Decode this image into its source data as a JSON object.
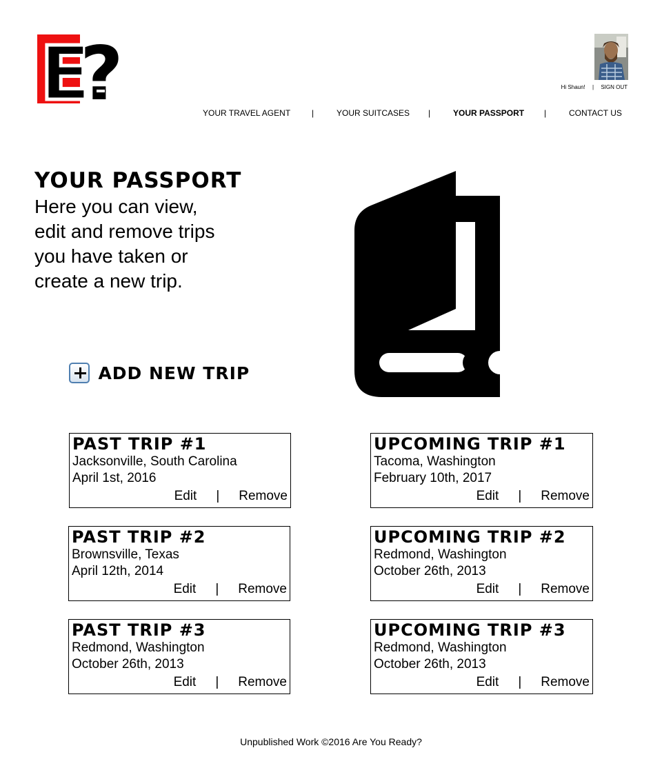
{
  "header": {
    "logo_letters": "E?",
    "greeting": "Hi Shaun!",
    "separator": "|",
    "sign_out": "SIGN OUT"
  },
  "nav": {
    "items": [
      {
        "label": "YOUR TRAVEL AGENT",
        "active": false
      },
      {
        "label": "YOUR SUITCASES",
        "active": false
      },
      {
        "label": "YOUR PASSPORT",
        "active": true
      },
      {
        "label": "CONTACT US",
        "active": false
      }
    ],
    "separator": "|"
  },
  "hero": {
    "title": "YOUR PASSPORT",
    "intro": "Here you can view, edit and remove trips you have taken or create a new trip.",
    "add_trip_label": "ADD NEW TRIP",
    "icon": "passport-book-icon"
  },
  "trips": {
    "past": [
      {
        "title": "PAST TRIP #1",
        "location": "Jacksonville, South Carolina",
        "date": "April 1st, 2016"
      },
      {
        "title": "PAST TRIP #2",
        "location": "Brownsville, Texas",
        "date": "April 12th, 2014"
      },
      {
        "title": "PAST TRIP #3",
        "location": "Redmond, Washington",
        "date": "October 26th, 2013"
      }
    ],
    "upcoming": [
      {
        "title": "UPCOMING TRIP #1",
        "location": "Tacoma, Washington",
        "date": "February 10th, 2017"
      },
      {
        "title": "UPCOMING TRIP #2",
        "location": "Redmond, Washington",
        "date": "October 26th, 2013"
      },
      {
        "title": "UPCOMING TRIP #3",
        "location": "Redmond, Washington",
        "date": "October 26th, 2013"
      }
    ],
    "edit_label": "Edit",
    "remove_label": "Remove",
    "action_separator": "|"
  },
  "footer": {
    "text": "Unpublished Work ©2016 Are You Ready?"
  },
  "colors": {
    "logo_red": "#ee1111",
    "text": "#000000",
    "background": "#ffffff",
    "add_icon_border": "#4f7fb0"
  }
}
